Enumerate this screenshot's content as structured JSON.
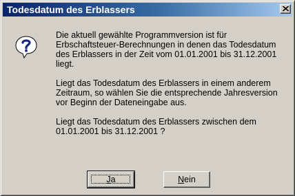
{
  "dialog": {
    "title": "Todesdatum des Erblassers",
    "icon": "question-icon",
    "message_lines": [
      "Die aktuell gewählte Programmversion ist für",
      "Erbschaftsteuer-Berechnungen in denen das Todesdatum",
      "des Erblassers in der Zeit vom 01.01.2001 bis 31.12.2001",
      "liegt."
    ],
    "message2_lines": [
      "Liegt das Todesdatum des Erblassers in einem anderem",
      "Zeitraum, so wählen Sie die entsprechende Jahresversion",
      "vor Beginn der Dateneingabe aus."
    ],
    "message3_lines": [
      "Liegt das Todesdatum des Erblassers zwischen dem",
      "01.01.2001 bis 31.12.2001 ?"
    ],
    "buttons": {
      "yes": {
        "accel": "J",
        "rest": "a"
      },
      "no": {
        "accel": "N",
        "rest": "ein"
      }
    }
  }
}
